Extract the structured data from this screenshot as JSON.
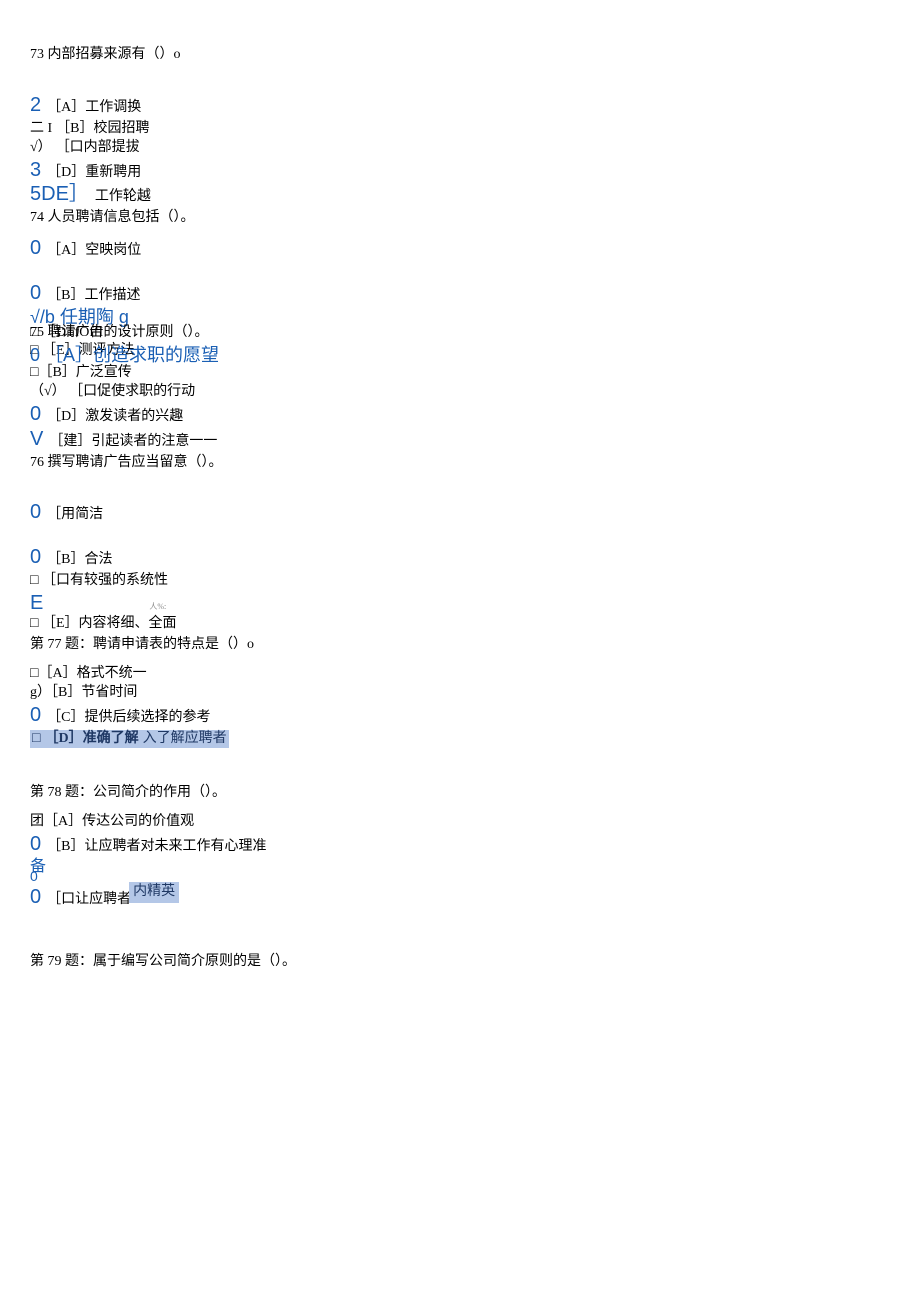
{
  "q73": {
    "stem": "73 内部招募来源有（）o",
    "a": {
      "mark": "2",
      "text": "［A］工作调换"
    },
    "b": {
      "mark": "二 I",
      "text": "［B］校园招聘"
    },
    "c": {
      "mark": "√）",
      "text": "［口内部提拔"
    },
    "d": {
      "mark": "3",
      "text": "［D］重新聘用"
    },
    "e": {
      "mark": "5DE］",
      "text": "工作轮越"
    }
  },
  "q74": {
    "stem": "74 人员聘请信息包括（）。",
    "a": {
      "mark": "0",
      "text": "［A］空映岗位"
    },
    "b": {
      "mark": "0",
      "text": "［B］工作描述"
    },
    "c_top": "√/b 任期陶 g",
    "c_under": "□ ［DTfOffI",
    "d_top": "□ ［E］测评方法",
    "d_under": "0 ［A］创造求职的愿望"
  },
  "q75": {
    "stem_overlay": "75 聘请广告的设计原则（）。",
    "b": "□［B］广泛宣传",
    "c": "（√） ［口促使求职的行动",
    "d": {
      "mark": "0",
      "text": "［D］激发读者的兴趣"
    },
    "e": {
      "mark": "V",
      "text": "［建］引起读者的注意一一"
    }
  },
  "q76": {
    "stem": "76 撰写聘请广告应当留意（）。",
    "a": {
      "mark": "0",
      "text": "［用简洁"
    },
    "b": {
      "mark": "0",
      "text": "［B］合法"
    },
    "c": "□ ［口有较强的系统性",
    "d_mark": "E",
    "d_tiny": "人%:",
    "e": "□ ［E］内容将细、全面"
  },
  "q77": {
    "stem": "第 77 题：聘请申请表的特点是（）o",
    "a": "□［A］格式不统一",
    "b": "g）［B］节省时间",
    "c": {
      "mark": "0",
      "text": "［C］提供后续选择的参考"
    },
    "d_hl1": "□",
    "d_hl2": "［D］准确了解",
    "d_hl3": "入了解应聘者"
  },
  "q78": {
    "stem": "第 78 题：公司简介的作用（）。",
    "a": "团［A］传达公司的价值观",
    "b": {
      "mark": "0",
      "text": "［B］让应聘者对未来工作有心理准"
    },
    "c_mark": "备",
    "c_sub": "0",
    "d_mark": "0",
    "d_text_pre": "［口让应聘者",
    "d_hl": "内精英",
    "d_text_post": ""
  },
  "q79": {
    "stem": "第 79 题：属于编写公司简介原则的是（）。"
  }
}
